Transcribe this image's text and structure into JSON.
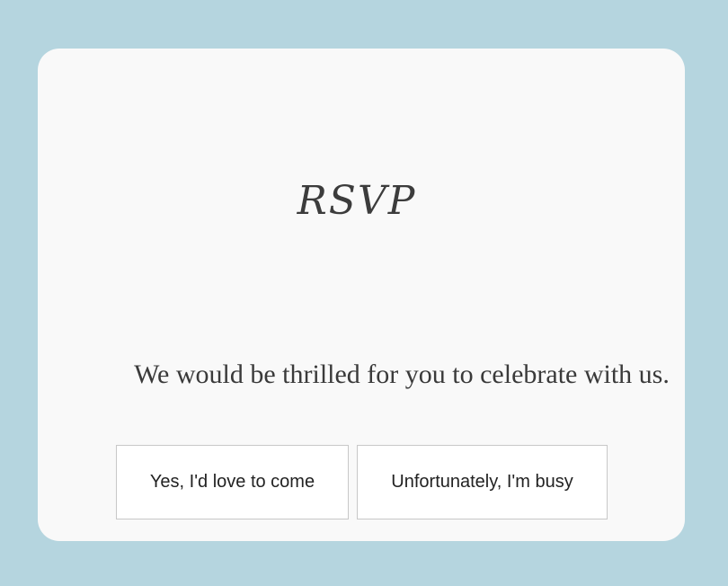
{
  "rsvp": {
    "title": "RSVP",
    "message": "We would be thrilled for you to celebrate with us.",
    "accept_label": "Yes, I'd love to come",
    "decline_label": "Unfortunately, I'm busy"
  },
  "colors": {
    "background": "#b5d5df",
    "card": "#f9f9f9",
    "text": "#3a3a3a",
    "button_border": "#c8c8c8"
  }
}
